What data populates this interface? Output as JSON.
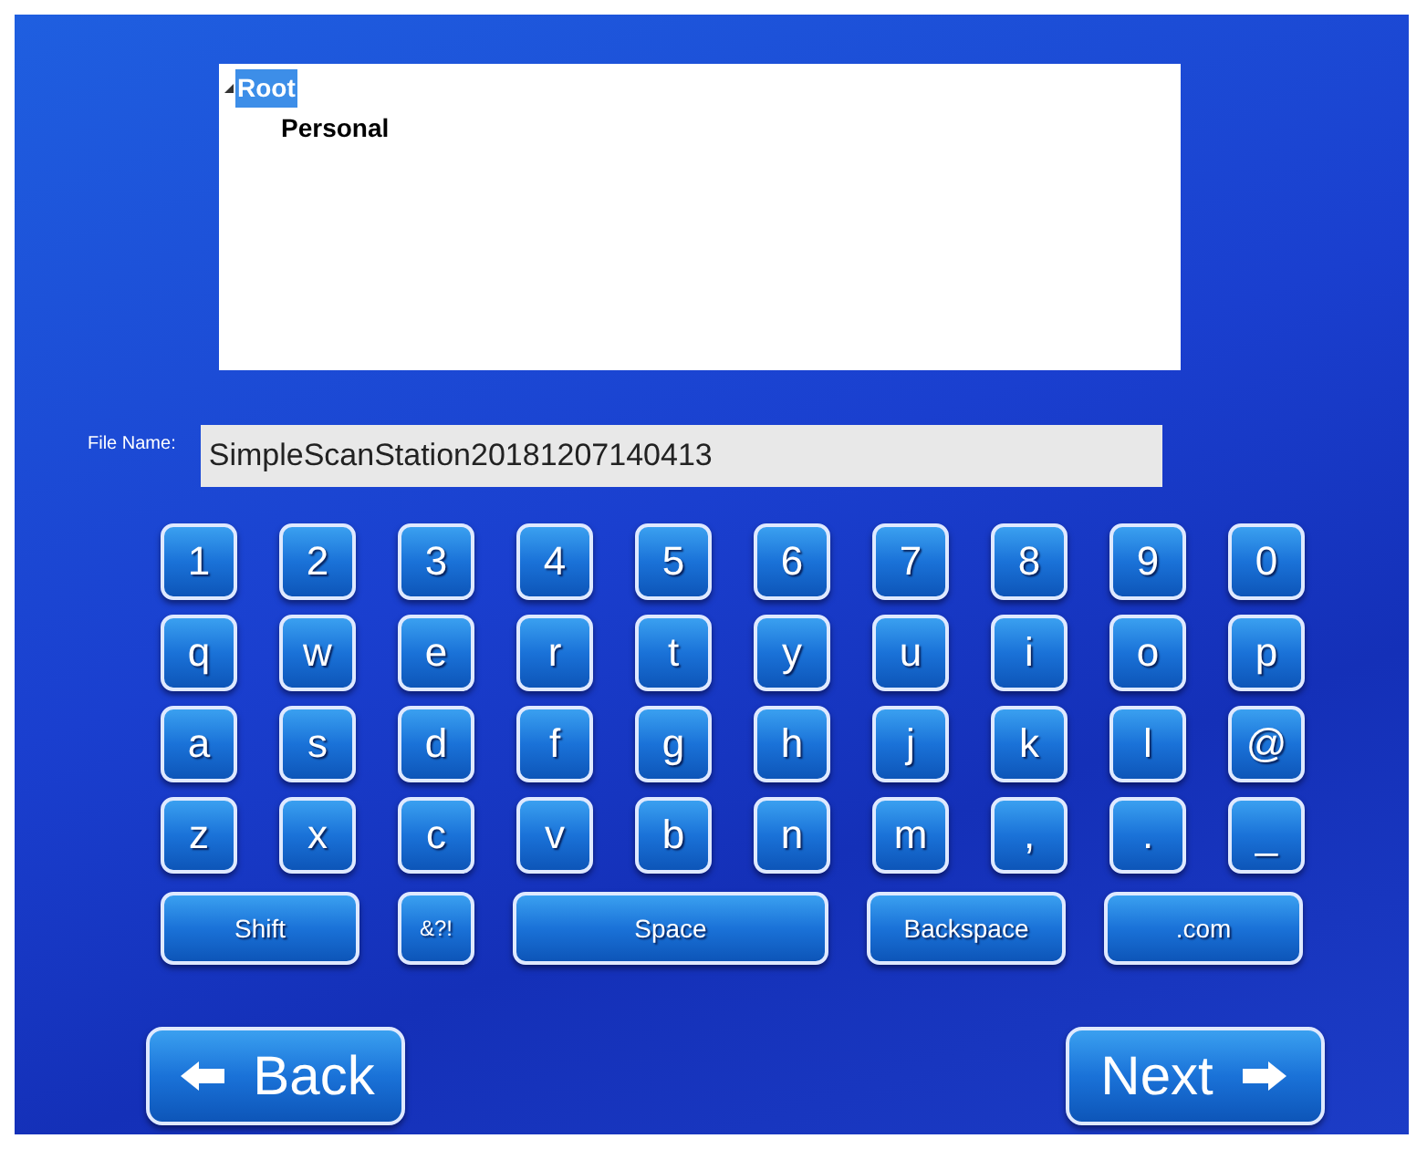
{
  "tree": [
    {
      "label": "Root",
      "selected": true,
      "expanded": true,
      "children": [
        {
          "label": "Personal",
          "selected": false
        }
      ]
    }
  ],
  "file_name": {
    "label": "File Name:",
    "value": "SimpleScanStation20181207140413"
  },
  "keyboard": [
    [
      {
        "label": "1",
        "kind": "key"
      },
      {
        "label": "2",
        "kind": "key"
      },
      {
        "label": "3",
        "kind": "key"
      },
      {
        "label": "4",
        "kind": "key"
      },
      {
        "label": "5",
        "kind": "key"
      },
      {
        "label": "6",
        "kind": "key"
      },
      {
        "label": "7",
        "kind": "key"
      },
      {
        "label": "8",
        "kind": "key"
      },
      {
        "label": "9",
        "kind": "key"
      },
      {
        "label": "0",
        "kind": "key"
      }
    ],
    [
      {
        "label": "q",
        "kind": "key"
      },
      {
        "label": "w",
        "kind": "key"
      },
      {
        "label": "e",
        "kind": "key"
      },
      {
        "label": "r",
        "kind": "key"
      },
      {
        "label": "t",
        "kind": "key"
      },
      {
        "label": "y",
        "kind": "key"
      },
      {
        "label": "u",
        "kind": "key"
      },
      {
        "label": "i",
        "kind": "key"
      },
      {
        "label": "o",
        "kind": "key"
      },
      {
        "label": "p",
        "kind": "key"
      }
    ],
    [
      {
        "label": "a",
        "kind": "key"
      },
      {
        "label": "s",
        "kind": "key"
      },
      {
        "label": "d",
        "kind": "key"
      },
      {
        "label": "f",
        "kind": "key"
      },
      {
        "label": "g",
        "kind": "key"
      },
      {
        "label": "h",
        "kind": "key"
      },
      {
        "label": "j",
        "kind": "key"
      },
      {
        "label": "k",
        "kind": "key"
      },
      {
        "label": "l",
        "kind": "key"
      },
      {
        "label": "@",
        "kind": "key"
      }
    ],
    [
      {
        "label": "z",
        "kind": "key"
      },
      {
        "label": "x",
        "kind": "key"
      },
      {
        "label": "c",
        "kind": "key"
      },
      {
        "label": "v",
        "kind": "key"
      },
      {
        "label": "b",
        "kind": "key"
      },
      {
        "label": "n",
        "kind": "key"
      },
      {
        "label": "m",
        "kind": "key"
      },
      {
        "label": ",",
        "kind": "key"
      },
      {
        "label": ".",
        "kind": "key"
      },
      {
        "label": "_",
        "kind": "key"
      }
    ],
    [
      {
        "label": "Shift",
        "kind": "wide"
      },
      {
        "label": "&?!",
        "kind": "small"
      },
      {
        "label": "Space",
        "kind": "space"
      },
      {
        "label": "Backspace",
        "kind": "wide"
      },
      {
        "label": ".com",
        "kind": "wide"
      }
    ]
  ],
  "nav": [
    {
      "label": "Back",
      "kind": "back"
    },
    {
      "label": "Next",
      "kind": "next"
    }
  ]
}
